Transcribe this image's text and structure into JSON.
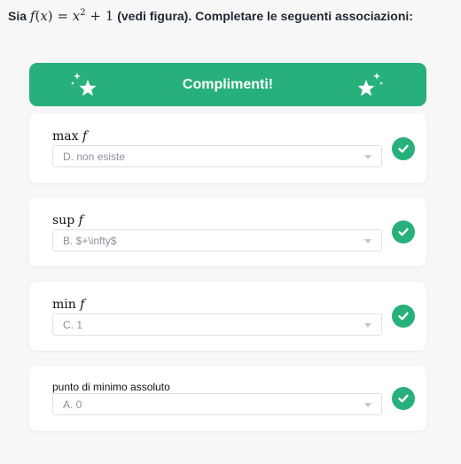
{
  "question": {
    "prefix": "Sia",
    "function_name": "f",
    "variable": "x",
    "exponent": "2",
    "constant": "1",
    "suffix": "(vedi figura). Completare le seguenti associazioni:"
  },
  "banner": {
    "title": "Complimenti!",
    "icons": [
      "sparkle-star-icon",
      "sparkle-star-icon"
    ],
    "color": "#27b07b"
  },
  "items": [
    {
      "label_op": "max",
      "label_fn": "f",
      "selected": "D. non esiste",
      "status_icon": "check-icon"
    },
    {
      "label_op": "sup",
      "label_fn": "f",
      "selected": "B. $+\\infty$",
      "status_icon": "check-icon"
    },
    {
      "label_op": "min",
      "label_fn": "f",
      "selected": "C. 1",
      "status_icon": "check-icon"
    },
    {
      "label_text": "punto di minimo assoluto",
      "selected": "A. 0",
      "status_icon": "check-icon"
    }
  ],
  "colors": {
    "success": "#27b07b",
    "background": "#f7f7f8",
    "card": "#ffffff"
  }
}
